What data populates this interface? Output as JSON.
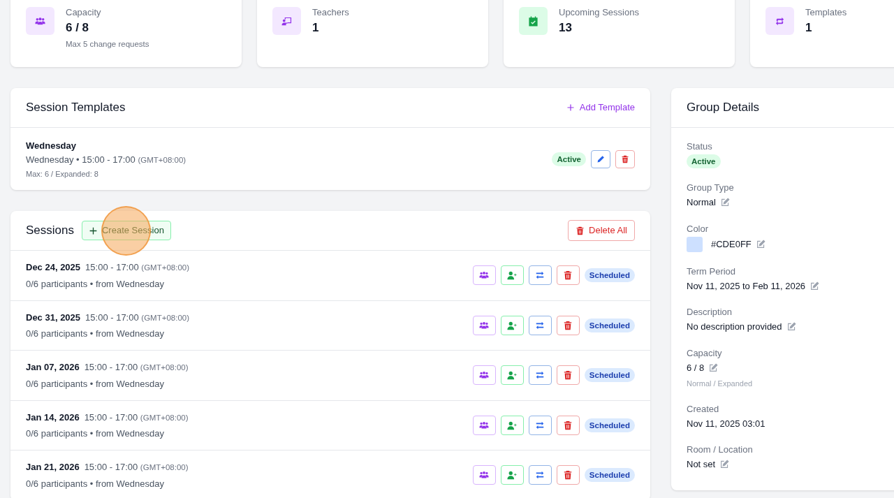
{
  "stats": [
    {
      "kind": "people",
      "label": "Capacity",
      "value": "6 / 8",
      "note": "Max 5 change requests"
    },
    {
      "kind": "teacher",
      "label": "Teachers",
      "value": "1"
    },
    {
      "kind": "calendar",
      "label": "Upcoming Sessions",
      "value": "13"
    },
    {
      "kind": "repeat",
      "label": "Templates",
      "value": "1"
    }
  ],
  "templates": {
    "title": "Session Templates",
    "add_button": "Add Template",
    "items": [
      {
        "name": "Wednesday",
        "schedule": "Wednesday • 15:00 - 17:00",
        "timezone": "(GMT+08:00)",
        "limits": "Max: 6 / Expanded: 8",
        "status": "Active"
      }
    ]
  },
  "sessions": {
    "title": "Sessions",
    "create_button": "Create Session",
    "delete_all_button": "Delete All",
    "rows": [
      {
        "date": "Dec 24, 2025",
        "time": "15:00 - 17:00",
        "timezone": "(GMT+08:00)",
        "info": "0/6 participants • from Wednesday",
        "status": "Scheduled"
      },
      {
        "date": "Dec 31, 2025",
        "time": "15:00 - 17:00",
        "timezone": "(GMT+08:00)",
        "info": "0/6 participants • from Wednesday",
        "status": "Scheduled"
      },
      {
        "date": "Jan 07, 2026",
        "time": "15:00 - 17:00",
        "timezone": "(GMT+08:00)",
        "info": "0/6 participants • from Wednesday",
        "status": "Scheduled"
      },
      {
        "date": "Jan 14, 2026",
        "time": "15:00 - 17:00",
        "timezone": "(GMT+08:00)",
        "info": "0/6 participants • from Wednesday",
        "status": "Scheduled"
      },
      {
        "date": "Jan 21, 2026",
        "time": "15:00 - 17:00",
        "timezone": "(GMT+08:00)",
        "info": "0/6 participants • from Wednesday",
        "status": "Scheduled"
      }
    ]
  },
  "details": {
    "title": "Group Details",
    "fields": [
      {
        "kind": "badge",
        "label": "Status",
        "value": "Active",
        "editable": false
      },
      {
        "kind": "text",
        "label": "Group Type",
        "value": "Normal",
        "editable": true
      },
      {
        "kind": "color",
        "label": "Color",
        "value": "#CDE0FF",
        "color": "#cde0ff",
        "editable": true
      },
      {
        "kind": "text",
        "label": "Term Period",
        "value": "Nov 11, 2025 to Feb 11, 2026",
        "editable": true
      },
      {
        "kind": "text",
        "label": "Description",
        "value": "No description provided",
        "editable": true
      },
      {
        "kind": "text",
        "label": "Capacity",
        "value": "6 / 8",
        "note": "Normal / Expanded",
        "editable": true
      },
      {
        "kind": "text",
        "label": "Created",
        "value": "Nov 11, 2025 03:01",
        "editable": false
      },
      {
        "kind": "text",
        "label": "Room / Location",
        "value": "Not set",
        "editable": true
      }
    ]
  }
}
